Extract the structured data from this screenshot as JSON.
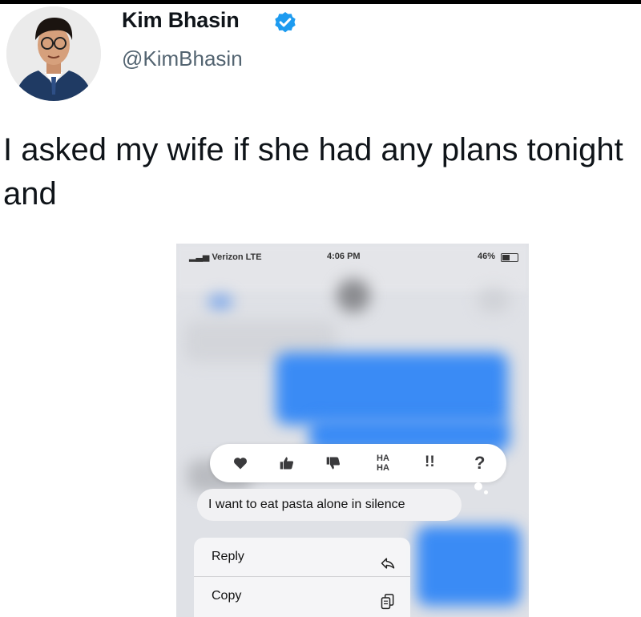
{
  "author": {
    "name": "Kim Bhasin",
    "handle": "@KimBhasin",
    "verified": true
  },
  "tweet": {
    "text": "I asked my wife if she had any plans tonight and"
  },
  "phone": {
    "status": {
      "carrier": "Verizon",
      "network": "LTE",
      "time": "4:06 PM",
      "battery": "46%"
    },
    "reactions": [
      {
        "icon": "heart-icon"
      },
      {
        "icon": "thumbs-up-icon"
      },
      {
        "icon": "thumbs-down-icon"
      },
      {
        "icon": "haha-icon",
        "label": "HA"
      },
      {
        "icon": "exclamation-icon",
        "label": "!!"
      },
      {
        "icon": "question-icon",
        "label": "?"
      }
    ],
    "message": "I want to eat pasta alone in silence",
    "menu": {
      "reply_label": "Reply",
      "copy_label": "Copy"
    }
  },
  "colors": {
    "verified_blue": "#1d9bf0",
    "imessage_blue": "#3a8bf5",
    "handle_gray": "#536471"
  }
}
